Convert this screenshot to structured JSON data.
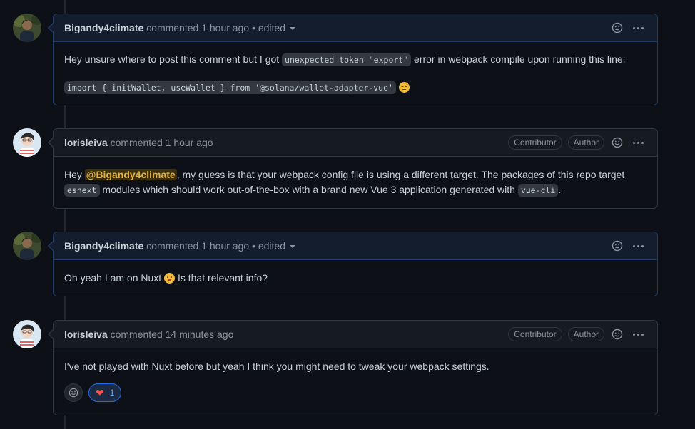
{
  "comments": [
    {
      "author": "Bigandy4climate",
      "action": "commented",
      "time": "1 hour ago",
      "edited": "• edited",
      "body_parts": {
        "p1_a": "Hey unsure where to post this comment but I got ",
        "p1_code": "unexpected token \"export\"",
        "p1_b": " error in webpack compile upon running this line:",
        "p2_code": "import { initWallet, useWallet } from '@solana/wallet-adapter-vue'"
      }
    },
    {
      "author": "lorisleiva",
      "action": "commented",
      "time": "1 hour ago",
      "labels": [
        "Contributor",
        "Author"
      ],
      "body_parts": {
        "a": "Hey ",
        "mention": "@Bigandy4climate",
        "b": ", my guess is that your webpack config file is using a different target. The packages of this repo target ",
        "code1": "esnext",
        "c": " modules which should work out-of-the-box with a brand new Vue 3 application generated with ",
        "code2": "vue-cli",
        "d": "."
      }
    },
    {
      "author": "Bigandy4climate",
      "action": "commented",
      "time": "1 hour ago",
      "edited": "• edited",
      "body_parts": {
        "a": "Oh yeah I am on Nuxt ",
        "b": " Is that relevant info?"
      }
    },
    {
      "author": "lorisleiva",
      "action": "commented",
      "time": "14 minutes ago",
      "labels": [
        "Contributor",
        "Author"
      ],
      "body": "I've not played with Nuxt before but yeah I think you might need to tweak your webpack settings.",
      "reaction_count": "1"
    }
  ],
  "icons": {
    "reaction": "smiley-icon",
    "menu": "kebab-horizontal-icon",
    "heart": "heart-icon"
  },
  "colors": {
    "background": "#0d1117",
    "border": "#30363d",
    "self_border": "#1f3b66",
    "mention_bg": "#3b2e0b",
    "mention_fg": "#e3b341",
    "reaction_blue": "#58a6ff",
    "heart_red": "#f85149"
  }
}
